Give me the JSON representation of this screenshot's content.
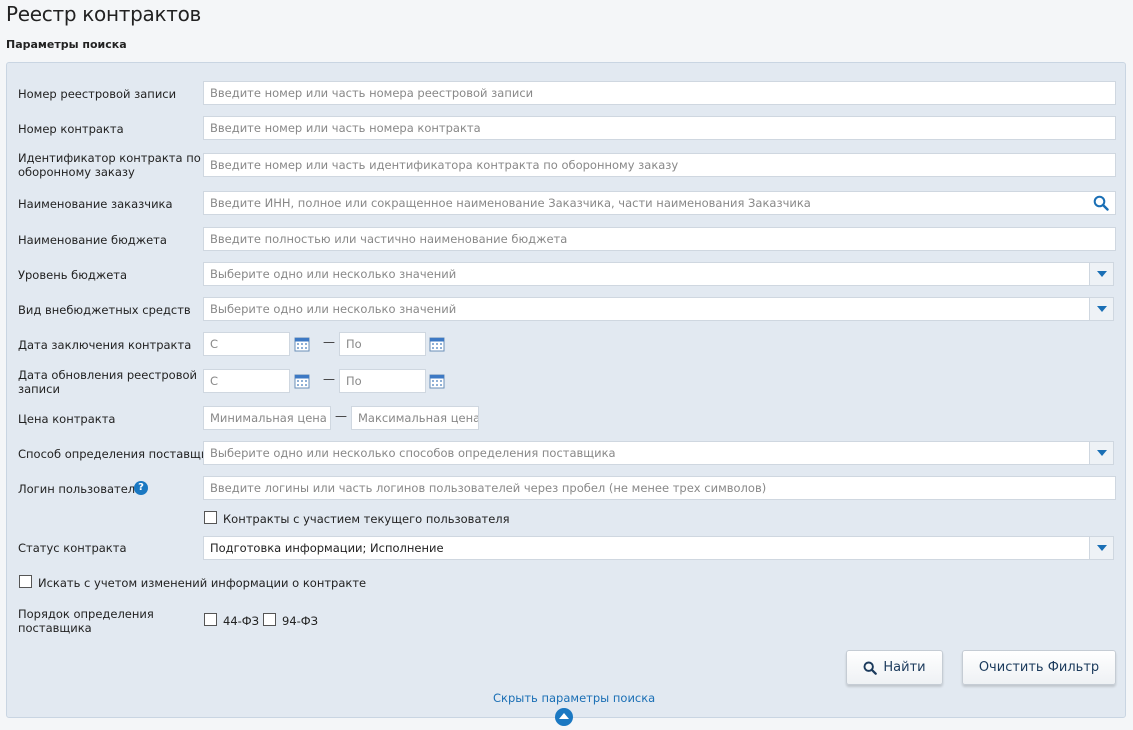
{
  "page": {
    "title": "Реестр контрактов",
    "section_title": "Параметры поиска"
  },
  "form": {
    "registry_number": {
      "label": "Номер реестровой записи",
      "placeholder": "Введите номер или часть номера реестровой записи"
    },
    "contract_number": {
      "label": "Номер контракта",
      "placeholder": "Введите номер или часть номера контракта"
    },
    "defense_id": {
      "label_line1": "Идентификатор контракта по",
      "label_line2": "оборонному заказу",
      "placeholder": "Введите номер или часть идентификатора контракта по оборонному заказу"
    },
    "customer_name": {
      "label": "Наименование заказчика",
      "placeholder": "Введите ИНН, полное или сокращенное наименование Заказчика, части наименования Заказчика"
    },
    "budget_name": {
      "label": "Наименование бюджета",
      "placeholder": "Введите полностью или частично наименование бюджета"
    },
    "budget_level": {
      "label": "Уровень бюджета",
      "placeholder": "Выберите одно или несколько значений"
    },
    "extrabudget_type": {
      "label": "Вид внебюджетных средств",
      "placeholder": "Выберите одно или несколько значений"
    },
    "contract_date": {
      "label": "Дата заключения контракта",
      "from_placeholder": "С",
      "to_placeholder": "По",
      "separator": "—"
    },
    "update_date": {
      "label_line1": "Дата обновления реестровой",
      "label_line2": "записи",
      "from_placeholder": "С",
      "to_placeholder": "По",
      "separator": "—"
    },
    "contract_price": {
      "label": "Цена контракта",
      "min_placeholder": "Минимальная цена",
      "max_placeholder": "Максимальная цена",
      "separator": "—"
    },
    "supplier_method": {
      "label": "Способ определения поставщика",
      "placeholder": "Выберите одно или несколько способов определения поставщика"
    },
    "user_login": {
      "label": "Логин пользователя",
      "help": "?",
      "placeholder": "Введите логины или часть логинов пользователей через пробел (не менее трех символов)"
    },
    "current_user_contracts": {
      "label": "Контракты с участием текущего пользователя"
    },
    "contract_status": {
      "label": "Статус контракта",
      "value": "Подготовка информации; Исполнение"
    },
    "search_with_changes": {
      "label": "Искать с учетом изменений информации о контракте"
    },
    "supplier_order": {
      "label_line1": "Порядок определения",
      "label_line2": "поставщика",
      "option_44": "44-ФЗ",
      "option_94": "94-ФЗ"
    }
  },
  "actions": {
    "find_label": "Найти",
    "clear_label": "Очистить Фильтр",
    "hide_link": "Скрыть параметры поиска"
  },
  "colors": {
    "accent": "#1a6fb5",
    "panel_bg": "#e2e9f1"
  }
}
